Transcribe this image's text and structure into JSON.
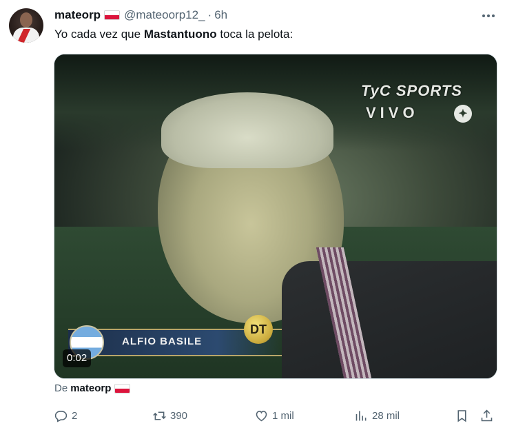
{
  "tweet": {
    "author_name": "mateorp",
    "author_handle": "@mateoorp12_",
    "separator": "·",
    "time": "6h",
    "text_before": "Yo cada vez que ",
    "text_bold": "Mastantuono",
    "text_after": " toca la pelota:"
  },
  "media": {
    "overlay_logo": "TyC SPORTS",
    "overlay_live": "VIVO",
    "caption_name": "ALFIO BASILE",
    "caption_badge": "DT",
    "video_time": "0:02"
  },
  "source": {
    "prefix": "De",
    "name": "mateorp"
  },
  "actions": {
    "replies": "2",
    "reposts": "390",
    "likes": "1 mil",
    "views": "28 mil"
  },
  "icons": {
    "flag": "poland-flag-icon",
    "more": "more-icon",
    "reply": "reply-icon",
    "repost": "repost-icon",
    "like": "like-icon",
    "views": "views-icon",
    "bookmark": "bookmark-icon",
    "share": "share-icon"
  },
  "colors": {
    "text_primary": "#0f1419",
    "text_secondary": "#536471",
    "border": "#cfd9de",
    "flag_red": "#dc143c"
  }
}
